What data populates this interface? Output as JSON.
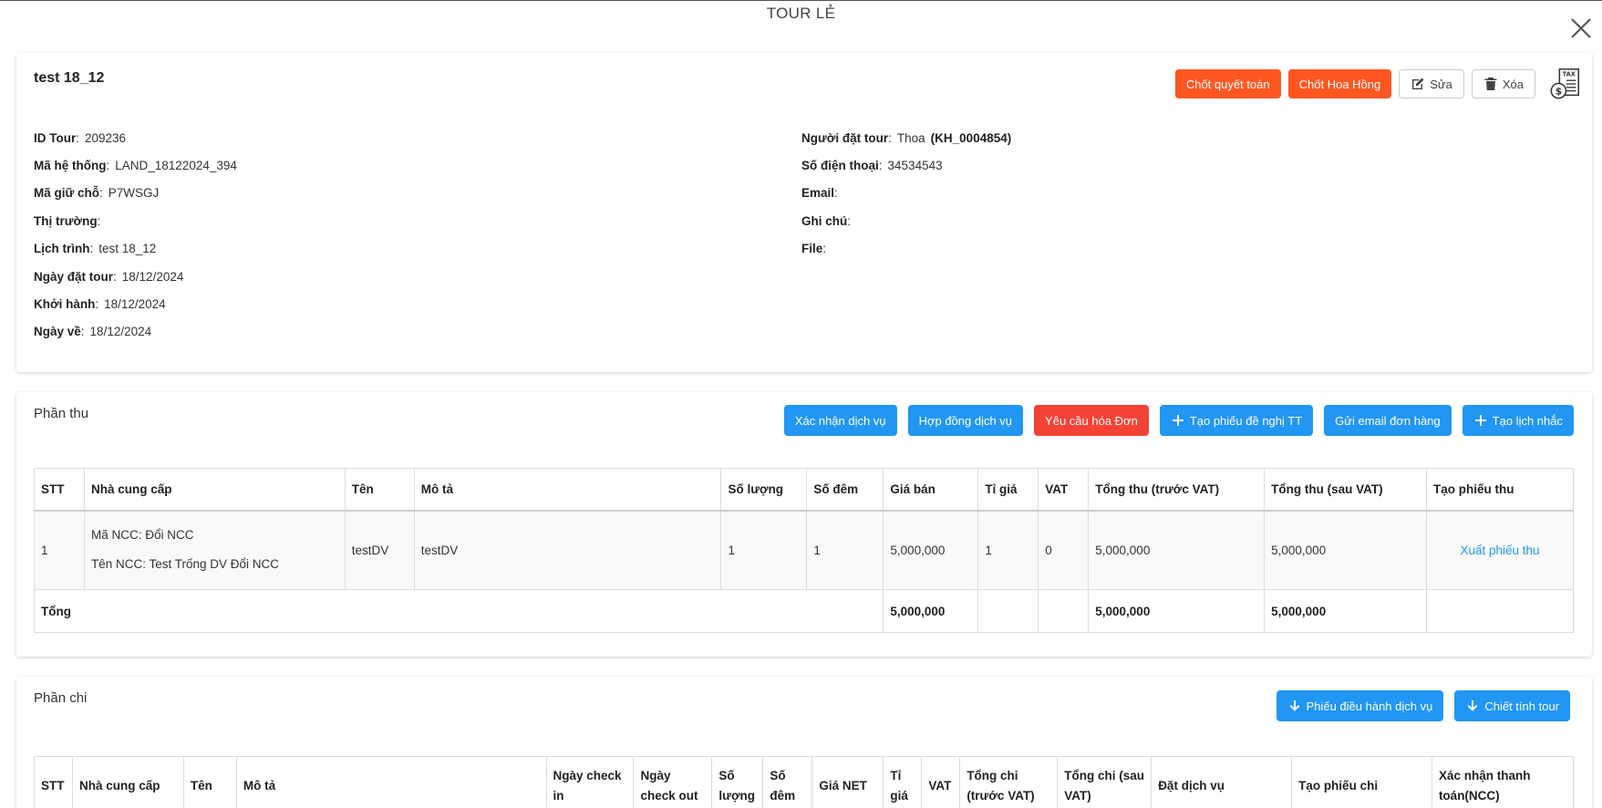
{
  "modal": {
    "title": "TOUR LẺ"
  },
  "tour": {
    "name": "test 18_12",
    "actions": {
      "chot_quyet_toan": "Chốt quyết toán",
      "chot_hoa_hong": "Chốt Hoa Hồng",
      "sua": "Sửa",
      "xoa": "Xóa"
    },
    "left_info": [
      {
        "label": "ID Tour",
        "value": "209236"
      },
      {
        "label": "Mã hệ thống",
        "value": "LAND_18122024_394"
      },
      {
        "label": "Mã giữ chỗ",
        "value": "P7WSGJ"
      },
      {
        "label": "Thị trường",
        "value": ""
      },
      {
        "label": "Lịch trình",
        "value": "test 18_12"
      },
      {
        "label": "Ngày đặt tour",
        "value": "18/12/2024"
      },
      {
        "label": "Khởi hành",
        "value": "18/12/2024"
      },
      {
        "label": "Ngày về",
        "value": "18/12/2024"
      }
    ],
    "right_info": [
      {
        "label": "Người đặt tour",
        "value": "Thoa",
        "code": "(KH_0004854)"
      },
      {
        "label": "Số điện thoại",
        "value": "34534543",
        "code": ""
      },
      {
        "label": "Email",
        "value": "",
        "code": ""
      },
      {
        "label": "Ghi chú",
        "value": "",
        "code": ""
      },
      {
        "label": "File",
        "value": "",
        "code": ""
      }
    ],
    "colon": ":"
  },
  "phan_thu": {
    "title": "Phần thu",
    "buttons": {
      "xac_nhan": "Xác nhận dịch vụ",
      "hop_dong": "Hợp đồng dịch vụ",
      "yeu_cau": "Yêu cầu hóa Đơn",
      "tao_phieu": "Tạo phiếu đề nghị TT",
      "gui_email": "Gửi email đơn hàng",
      "tao_lich": "Tạo lịch nhắc"
    },
    "columns": [
      "STT",
      "Nhà cung cấp",
      "Tên",
      "Mô tả",
      "Số lượng",
      "Số đêm",
      "Giá bán",
      "Tỉ giá",
      "VAT",
      "Tổng thu (trước VAT)",
      "Tổng thu (sau VAT)",
      "Tạo phiếu thu"
    ],
    "row": {
      "stt": "1",
      "ma_ncc": "Mã NCC: Đổi NCC",
      "ten_ncc": "Tên NCC: Test Trống DV Đổi NCC",
      "ten": "testDV",
      "mo_ta": "testDV",
      "so_luong": "1",
      "so_dem": "1",
      "gia_ban": "5,000,000",
      "ti_gia": "1",
      "vat": "0",
      "tong_truoc": "5,000,000",
      "tong_sau": "5,000,000",
      "xuat_phieu": "Xuất phiếu thu"
    },
    "total": {
      "label": "Tổng",
      "gia_ban": "5,000,000",
      "tong_truoc": "5,000,000",
      "tong_sau": "5,000,000"
    }
  },
  "phan_chi": {
    "title": "Phần chi",
    "buttons": {
      "phieu_dieu_hanh": "Phiếu điều hành dịch vụ",
      "chiet_tinh": "Chiết tính tour"
    },
    "columns": {
      "stt": "STT",
      "ncc": "Nhà cung cấp",
      "ten": "Tên",
      "mo_ta": "Mô tả",
      "check_in": "Ngày check in",
      "check_out": "Ngày check out",
      "so_luong": "Số lượng",
      "so_dem": "Số đêm",
      "gia_net": "Giá NET",
      "ti_gia": "Tỉ giá",
      "vat": "VAT",
      "tong_truoc": "Tổng chi (trước VAT)",
      "tong_sau": "Tổng chi (sau VAT)",
      "dat_dv": "Đặt dịch vụ",
      "tao_phieu_chi": "Tạo phiếu chi",
      "xac_nhan_tt": "Xác nhận thanh toán(NCC)"
    }
  },
  "colors": {
    "orange": "#ff5722",
    "red": "#f44336",
    "blue": "#2196f3"
  }
}
